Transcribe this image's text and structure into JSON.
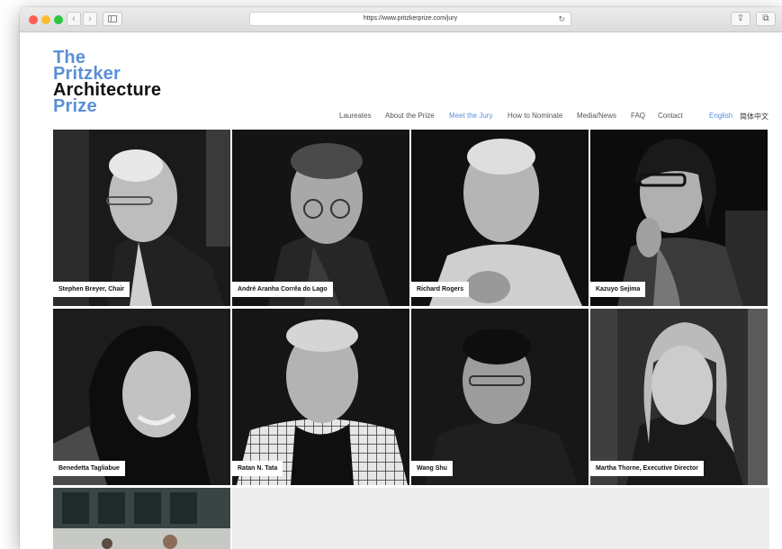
{
  "browser": {
    "url": "https://www.pritzkerprize.com/jury",
    "back_label": "‹",
    "forward_label": "›",
    "reload_label": "↻",
    "share_label": "⇪",
    "tabs_label": "⧉"
  },
  "logo": {
    "line1": "The",
    "line2": "Pritzker",
    "line3": "Architecture",
    "line4": "Prize"
  },
  "nav": {
    "items": [
      {
        "label": "Laureates"
      },
      {
        "label": "About the Prize"
      },
      {
        "label": "Meet the Jury"
      },
      {
        "label": "How to Nominate"
      },
      {
        "label": "Media/News"
      },
      {
        "label": "FAQ"
      },
      {
        "label": "Contact"
      }
    ],
    "active": "Meet the Jury",
    "lang_english": "English",
    "lang_chinese": "简体中文"
  },
  "jury": [
    {
      "name": "Stephen Breyer, Chair",
      "icon": "portrait-photo"
    },
    {
      "name": "André Aranha Corrêa do Lago",
      "icon": "portrait-photo"
    },
    {
      "name": "Richard Rogers",
      "icon": "portrait-photo"
    },
    {
      "name": "Kazuyo Sejima",
      "icon": "portrait-photo"
    },
    {
      "name": "Benedetta Tagliabue",
      "icon": "portrait-photo"
    },
    {
      "name": "Ratan N. Tata",
      "icon": "portrait-photo"
    },
    {
      "name": "Wang Shu",
      "icon": "portrait-photo"
    },
    {
      "name": "Martha Thorne, Executive Director",
      "icon": "portrait-photo"
    }
  ],
  "colors": {
    "accent": "#5b8fd6",
    "text": "#111111",
    "nav_text": "#555555",
    "empty_cell": "#ededed"
  }
}
